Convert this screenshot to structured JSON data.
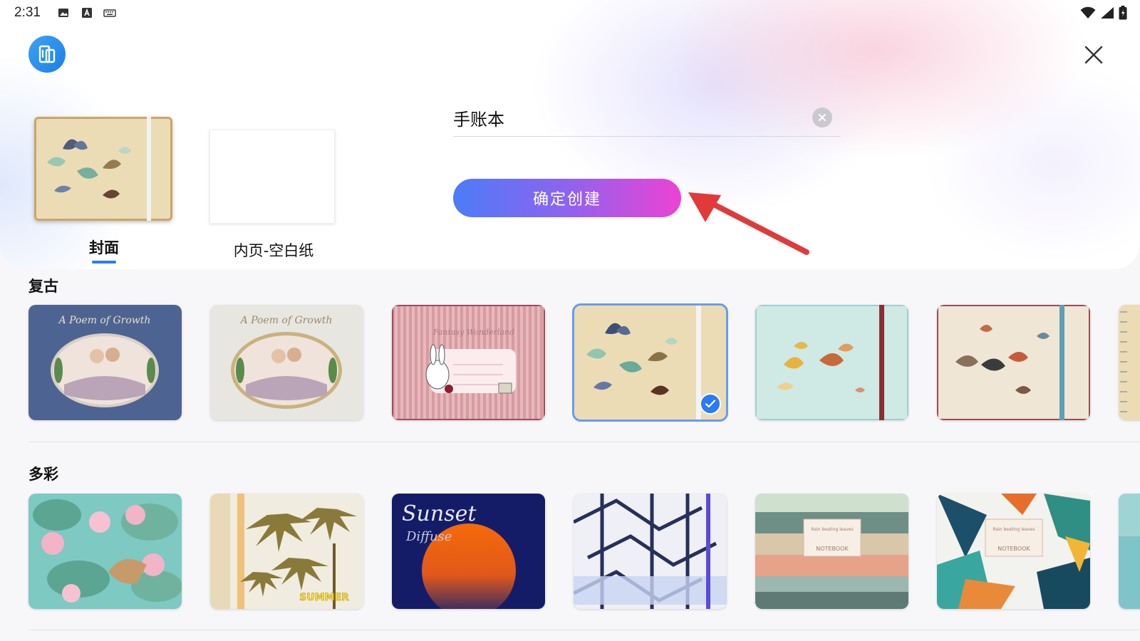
{
  "status_bar": {
    "time": "2:31",
    "icons": [
      "image-icon",
      "text-a-icon",
      "keyboard-icon"
    ],
    "right_icons": [
      "wifi-icon",
      "signal-icon",
      "battery-icon"
    ]
  },
  "header": {
    "app_icon": "notebook-switch-icon",
    "close_icon": "close-icon"
  },
  "tabs": [
    {
      "label": "封面",
      "selected": true
    },
    {
      "label": "内页-空白纸",
      "selected": false
    }
  ],
  "name_input": {
    "value": "手账本",
    "clear_icon": "clear-icon"
  },
  "confirm_button": {
    "label": "确定创建"
  },
  "sections": [
    {
      "title": "复古",
      "cards": [
        {
          "name": "poem-of-growth-blue",
          "text": "A Poem of Growth",
          "selected": false
        },
        {
          "name": "poem-of-growth-white",
          "text": "A Poem of Growth",
          "selected": false
        },
        {
          "name": "fantasy-wonderland",
          "text": "Fantasy Wonderland",
          "selected": false
        },
        {
          "name": "butterfly-beige",
          "text": "",
          "selected": true
        },
        {
          "name": "butterfly-mint",
          "text": "",
          "selected": false
        },
        {
          "name": "butterfly-cream",
          "text": "",
          "selected": false
        }
      ]
    },
    {
      "title": "多彩",
      "cards": [
        {
          "name": "lotus-pond",
          "text": "",
          "selected": false
        },
        {
          "name": "palm-summer",
          "text": "SUMMER",
          "selected": false
        },
        {
          "name": "sunset-diffuse",
          "text": "Sunset",
          "text2": "Diffuse",
          "selected": false
        },
        {
          "name": "architecture-white",
          "text": "",
          "selected": false
        },
        {
          "name": "wood-notebook",
          "text": "NOTEBOOK",
          "text2": "Rain beating leaves",
          "selected": false
        },
        {
          "name": "tropical-leaves",
          "text": "NOTEBOOK",
          "text2": "Rain beating leaves",
          "selected": false
        }
      ]
    }
  ],
  "colors": {
    "accent": "#2a7cf6",
    "button_gradient_start": "#4c7cf7",
    "button_gradient_end": "#ec43d3",
    "annotation_arrow": "#e03a3a"
  }
}
